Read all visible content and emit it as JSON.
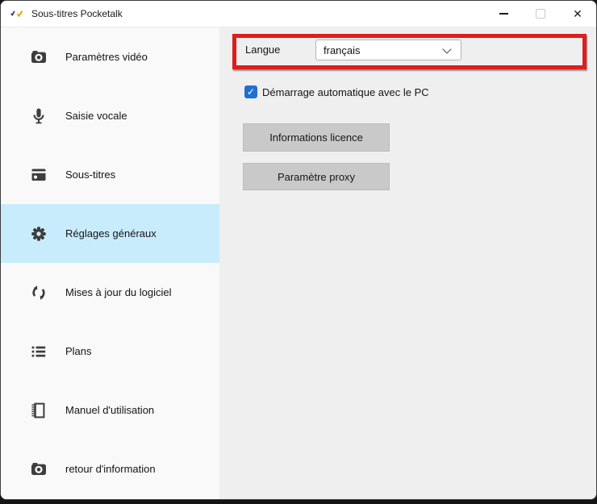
{
  "window": {
    "title": "Sous-titres Pocketalk"
  },
  "icons": {
    "close": "✕",
    "checkmark": "✓"
  },
  "sidebar": {
    "items": [
      {
        "label": "Paramètres vidéo",
        "icon": "camera-icon",
        "selected": false
      },
      {
        "label": "Saisie vocale",
        "icon": "microphone-icon",
        "selected": false
      },
      {
        "label": "Sous-titres",
        "icon": "subtitles-icon",
        "selected": false
      },
      {
        "label": "Réglages généraux",
        "icon": "gear-icon",
        "selected": true
      },
      {
        "label": "Mises à jour du logiciel",
        "icon": "software-update-icon",
        "selected": false
      },
      {
        "label": "Plans",
        "icon": "list-icon",
        "selected": false
      },
      {
        "label": "Manuel d'utilisation",
        "icon": "manual-book-icon",
        "selected": false
      },
      {
        "label": "retour d'information",
        "icon": "feedback-camera-icon",
        "selected": false
      }
    ]
  },
  "main": {
    "language_label": "Langue",
    "language_value": "français",
    "autostart_label": "Démarrage automatique avec le PC",
    "autostart_checked": true,
    "license_button": "Informations licence",
    "proxy_button": "Paramètre proxy"
  },
  "annotation": {
    "shape": "red-highlight-rectangle",
    "color": "#df1d1d"
  },
  "colors": {
    "sidebar_bg": "#faf9f9",
    "main_bg": "#efefef",
    "selected_item_bg": "#c9ecfd",
    "checkbox_blue": "#1f70d2",
    "button_gray": "#c9c9c9",
    "logo_navy": "#2b3a67",
    "logo_orange": "#f0a500"
  }
}
